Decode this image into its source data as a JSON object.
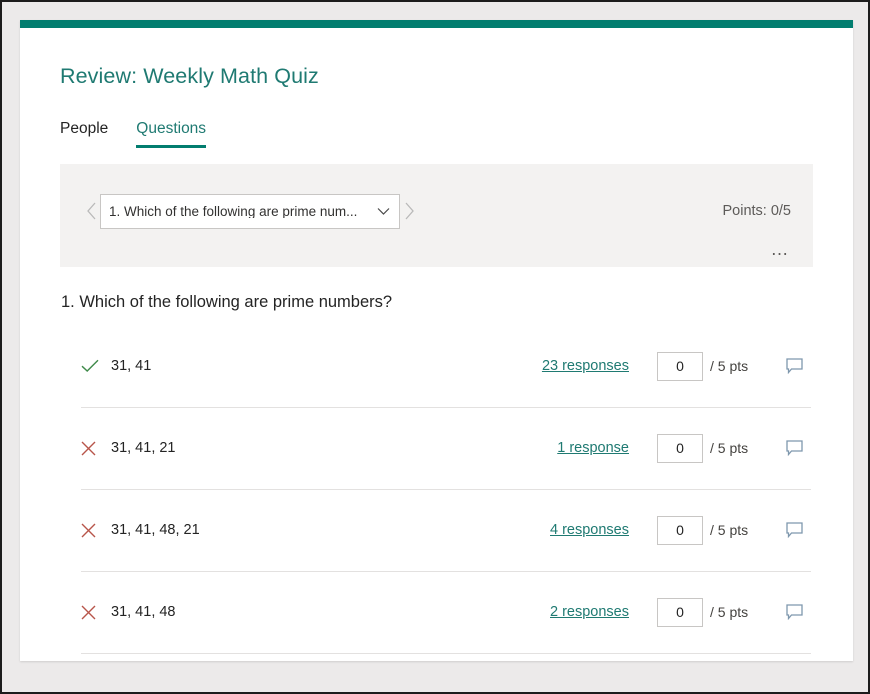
{
  "window": {
    "brand_color": "#027d6f",
    "page_background": "#ffffff",
    "outer_background": "#eceaea"
  },
  "header": {
    "title": "Review: Weekly Math Quiz",
    "title_color": "#1f7a72"
  },
  "tabs": [
    {
      "label": "People",
      "active": false
    },
    {
      "label": "Questions",
      "active": true
    }
  ],
  "selector": {
    "prev_icon": "chevron-left-icon",
    "next_icon": "chevron-right-icon",
    "dropdown_icon": "chevron-down-icon",
    "selected_question": "1. Which of the following are prime num...",
    "points_label": "Points: 0/5",
    "overflow_label": "…"
  },
  "question": {
    "heading": "1. Which of the following are prime numbers?",
    "answers": [
      {
        "status": "correct",
        "status_icon": "check-icon",
        "text": "31, 41",
        "responses_label": "23 responses",
        "score_value": "0",
        "score_suffix": "/ 5 pts",
        "comment_icon": "comment-icon"
      },
      {
        "status": "incorrect",
        "status_icon": "close-icon",
        "text": "31, 41, 21",
        "responses_label": "1 response",
        "score_value": "0",
        "score_suffix": "/ 5 pts",
        "comment_icon": "comment-icon"
      },
      {
        "status": "incorrect",
        "status_icon": "close-icon",
        "text": "31, 41, 48, 21",
        "responses_label": "4 responses",
        "score_value": "0",
        "score_suffix": "/ 5 pts",
        "comment_icon": "comment-icon"
      },
      {
        "status": "incorrect",
        "status_icon": "close-icon",
        "text": "31, 41, 48",
        "responses_label": "2 responses",
        "score_value": "0",
        "score_suffix": "/ 5 pts",
        "comment_icon": "comment-icon"
      }
    ]
  },
  "colors": {
    "accent": "#027d6f",
    "link": "#1f7a72",
    "correct": "#3f8a4a",
    "incorrect": "#b8554a",
    "panel": "#f3f2f1"
  }
}
